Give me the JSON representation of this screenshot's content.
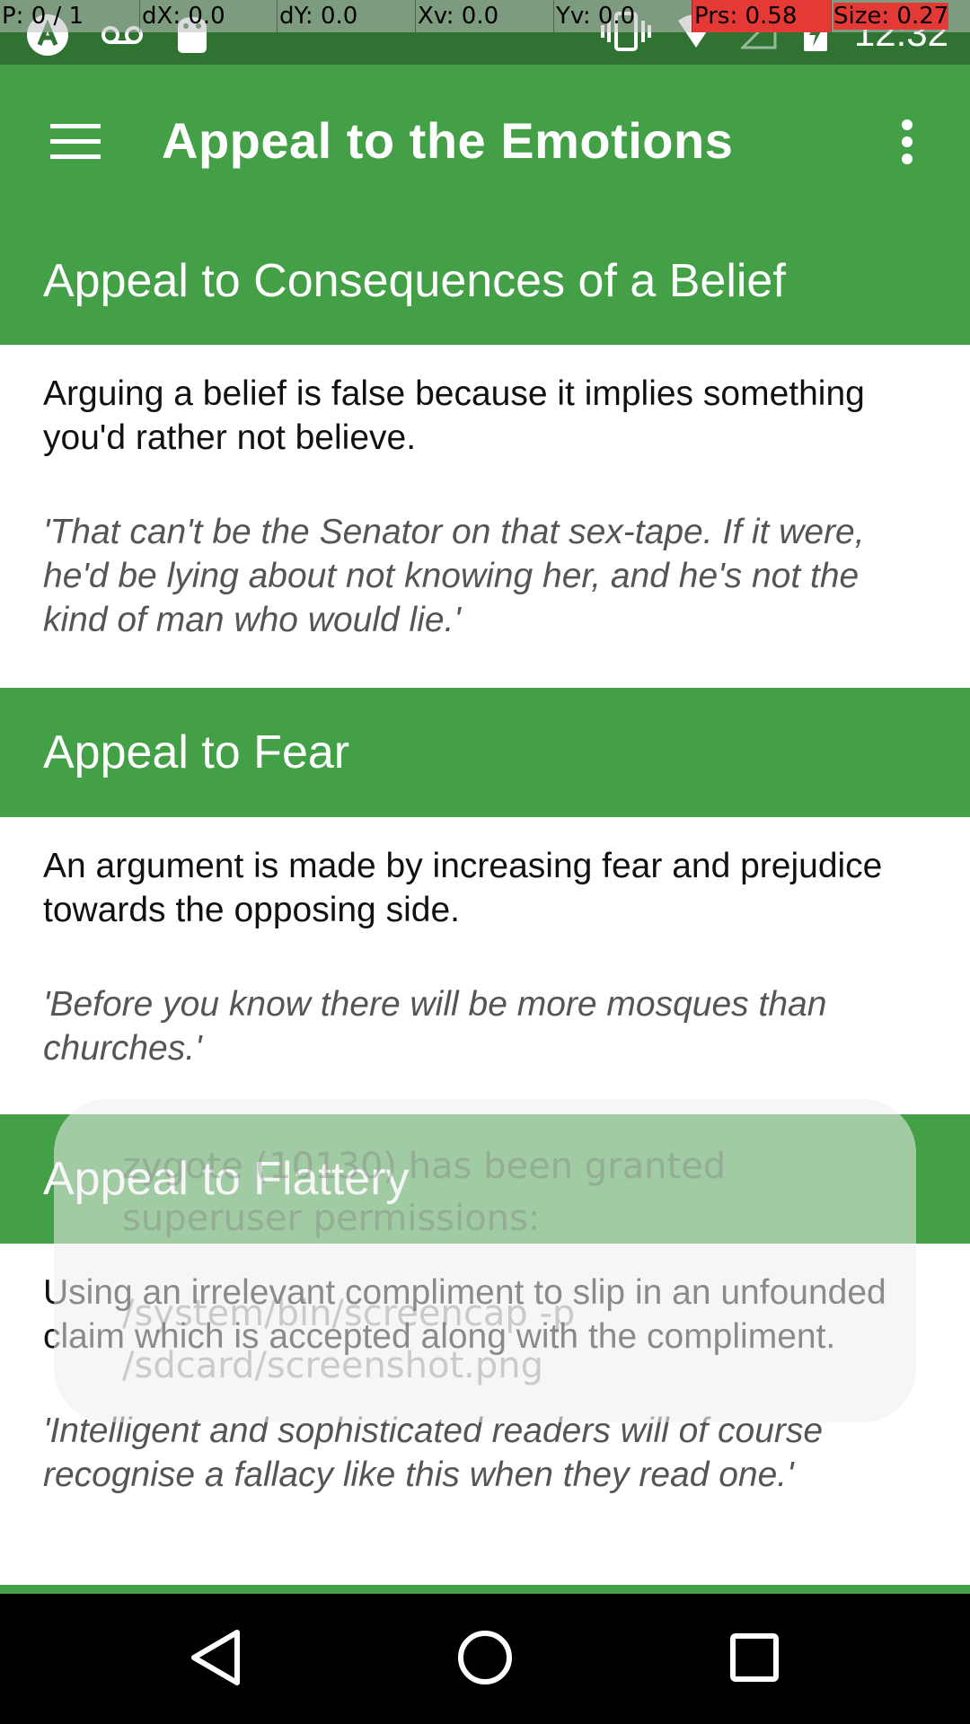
{
  "status_bar": {
    "time": "12:32",
    "pointer_location": {
      "p": "P: 0 / 1",
      "dx": "dX: 0.0",
      "dy": "dY: 0.0",
      "xv": "Xv: 0.0",
      "yv": "Yv: 0.0",
      "prs": "Prs: 0.58",
      "size": "Size: 0.27"
    },
    "icons_left": [
      "app-notification-icon",
      "voicemail-icon",
      "android-debug-icon"
    ],
    "icons_right": [
      "vibrate-icon",
      "wifi-icon",
      "cell-signal-icon",
      "battery-charging-icon"
    ]
  },
  "app_bar": {
    "title": "Appeal to the Emotions",
    "menu_icon": "hamburger-menu-icon",
    "overflow_icon": "more-vertical-icon"
  },
  "fallacies": [
    {
      "title": "Appeal to Consequences of a Belief",
      "definition": "Arguing a belief is false because it implies something you'd rather not believe.",
      "example": "'That can't be the Senator on that sex-tape. If it were, he'd be lying about not knowing her, and he's not the kind of man who would lie.'"
    },
    {
      "title": "Appeal to Fear",
      "definition": "An argument is made by increasing fear and prejudice towards the opposing side.",
      "example": "'Before you know there will be more mosques than churches.'"
    },
    {
      "title": "Appeal to Flattery",
      "definition": "Using an irrelevant compliment to slip in an unfounded claim which is accepted along with the compliment.",
      "example": "'Intelligent and sophisticated readers will of course recognise a fallacy like this when they read one.'"
    }
  ],
  "toast": {
    "line1": "zygote (10130) has been granted superuser permissions:",
    "line2": "/system/bin/screencap -p /sdcard/screenshot.png"
  },
  "nav_bar": {
    "back_icon": "back-triangle-icon",
    "home_icon": "home-circle-icon",
    "recents_icon": "recents-square-icon"
  },
  "colors": {
    "primary": "#43a047",
    "primary_dark": "#2f7232",
    "text": "#111111",
    "example_text": "#555555"
  }
}
